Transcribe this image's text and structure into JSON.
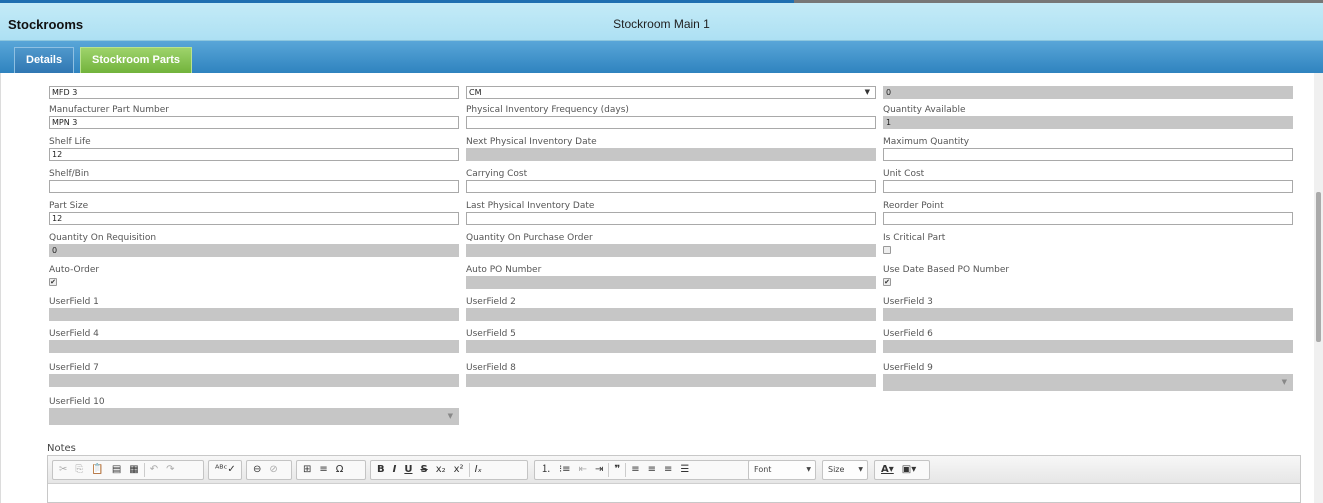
{
  "titlebar": {
    "app_title": "Stockrooms",
    "record_title": "Stockroom Main 1"
  },
  "tabs": [
    {
      "label": "Details"
    },
    {
      "label": "Stockroom Parts"
    }
  ],
  "form": {
    "top_row": {
      "col1_value": "MFD 3",
      "col2_value": "CM",
      "col3_value": "0"
    },
    "manufacturer_part_number": {
      "label": "Manufacturer Part Number",
      "value": "MPN 3"
    },
    "physical_inventory_frequency": {
      "label": "Physical Inventory Frequency (days)",
      "value": ""
    },
    "quantity_available": {
      "label": "Quantity Available",
      "value": "1"
    },
    "shelf_life": {
      "label": "Shelf Life",
      "value": "12"
    },
    "next_physical_inventory_date": {
      "label": "Next Physical Inventory Date",
      "value": ""
    },
    "maximum_quantity": {
      "label": "Maximum Quantity",
      "value": ""
    },
    "shelf_bin": {
      "label": "Shelf/Bin",
      "value": ""
    },
    "carrying_cost": {
      "label": "Carrying Cost",
      "value": ""
    },
    "unit_cost": {
      "label": "Unit Cost",
      "value": ""
    },
    "part_size": {
      "label": "Part Size",
      "value": "12"
    },
    "last_physical_inventory_date": {
      "label": "Last Physical Inventory Date",
      "value": ""
    },
    "reorder_point": {
      "label": "Reorder Point",
      "value": ""
    },
    "quantity_on_requisition": {
      "label": "Quantity On Requisition",
      "value": "0"
    },
    "quantity_on_purchase_order": {
      "label": "Quantity On Purchase Order",
      "value": ""
    },
    "is_critical_part": {
      "label": "Is Critical Part",
      "checked": false
    },
    "auto_order": {
      "label": "Auto-Order",
      "checked": true
    },
    "auto_po_number": {
      "label": "Auto PO Number",
      "value": ""
    },
    "use_date_based_po_number": {
      "label": "Use Date Based PO Number",
      "checked": true
    },
    "userfields": [
      {
        "label": "UserField 1"
      },
      {
        "label": "UserField 2"
      },
      {
        "label": "UserField 3"
      },
      {
        "label": "UserField 4"
      },
      {
        "label": "UserField 5"
      },
      {
        "label": "UserField 6"
      },
      {
        "label": "UserField 7"
      },
      {
        "label": "UserField 8"
      },
      {
        "label": "UserField 9"
      },
      {
        "label": "UserField 10"
      }
    ],
    "check_glyph": "✔"
  },
  "notes": {
    "label": "Notes",
    "toolbar": {
      "font_label": "Font",
      "size_label": "Size",
      "icons": [
        "cut-icon",
        "copy-icon",
        "paste-icon",
        "paste-text-icon",
        "paste-word-icon",
        "undo-icon",
        "redo-icon",
        "spellcheck-icon",
        "link-icon",
        "unlink-icon",
        "table-icon",
        "horizontal-rule-icon",
        "special-char-icon",
        "bold-icon",
        "italic-icon",
        "underline-icon",
        "strike-icon",
        "subscript-icon",
        "superscript-icon",
        "remove-format-icon",
        "numbered-list-icon",
        "bulleted-list-icon",
        "outdent-icon",
        "indent-icon",
        "blockquote-icon",
        "align-left-icon",
        "align-center-icon",
        "align-right-icon",
        "justify-icon",
        "text-color-icon",
        "background-color-icon"
      ]
    }
  },
  "colors": {
    "titlebar_bg": "#b8e6f5",
    "tabbar_bg": "#3f8fc9",
    "tab_active": "#84c24f",
    "readonly_field": "#c6c6c6"
  }
}
